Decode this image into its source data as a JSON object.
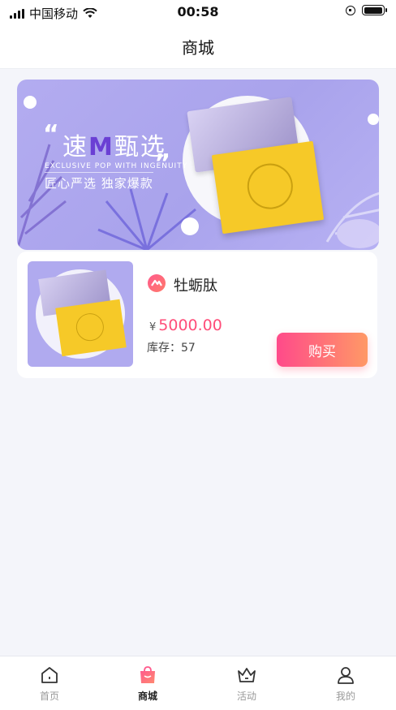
{
  "status_bar": {
    "carrier": "中国移动",
    "time": "00:58"
  },
  "nav": {
    "title": "商城"
  },
  "banner": {
    "title_prefix": "速",
    "title_m": "M",
    "title_suffix": "甄选",
    "subtitle_en": "EXCLUSIVE POP WITH INGENUITY",
    "subtitle_cn": "匠心严选   独家爆款"
  },
  "product": {
    "name": "牡蛎肽",
    "currency": "¥",
    "price": "5000.00",
    "stock": "库存：57",
    "buy_label": "购买"
  },
  "tabbar": {
    "tabs": [
      {
        "label": "首页",
        "icon": "home-icon",
        "active": false
      },
      {
        "label": "商城",
        "icon": "shopping-bag-icon",
        "active": true
      },
      {
        "label": "活动",
        "icon": "crown-icon",
        "active": false
      },
      {
        "label": "我的",
        "icon": "user-icon",
        "active": false
      }
    ]
  },
  "colors": {
    "accent": "#ff4d79",
    "banner_bg": "#b3acf0",
    "tab_active": "#222222"
  }
}
